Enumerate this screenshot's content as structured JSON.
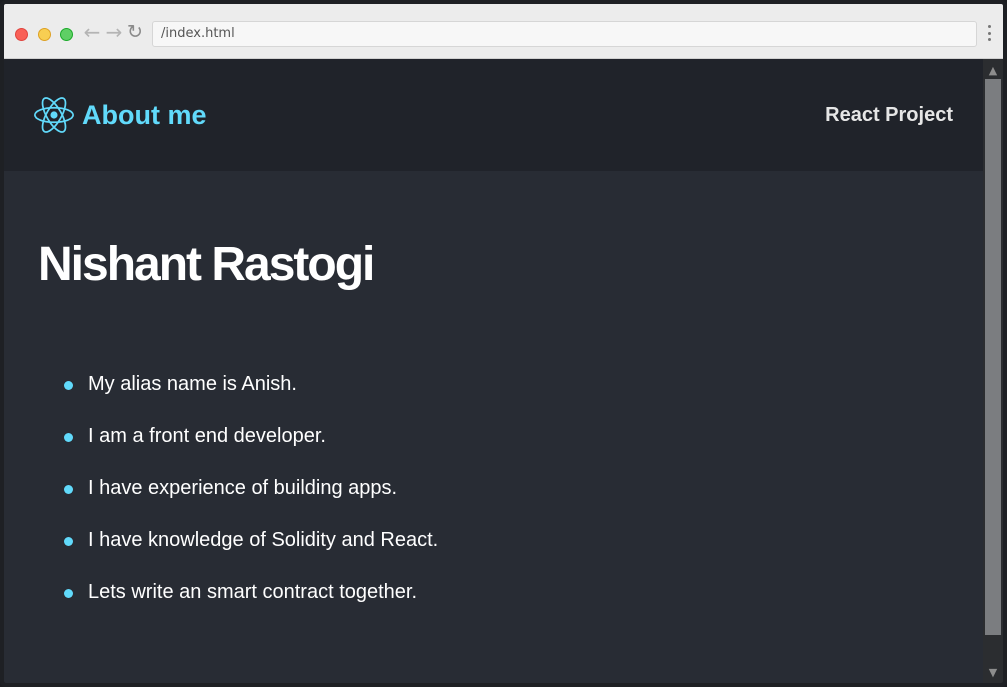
{
  "browser": {
    "address": "/index.html",
    "back_glyph": "←",
    "forward_glyph": "→",
    "reload_glyph": "↻",
    "scroll_up_glyph": "▲",
    "scroll_down_glyph": "▼"
  },
  "navbar": {
    "brand_title": "About me",
    "brand_icon": "react-logo-icon",
    "link_label": "React Project"
  },
  "main": {
    "title": "Nishant Rastogi",
    "facts": [
      "My alias name is Anish.",
      "I am a front end developer.",
      "I have experience of building apps.",
      "I have knowledge of Solidity and React.",
      "Lets write an smart contract together."
    ]
  },
  "colors": {
    "accent": "#61dafb",
    "navbar_bg": "#20232a",
    "page_bg": "#282c34",
    "text": "#ffffff"
  }
}
